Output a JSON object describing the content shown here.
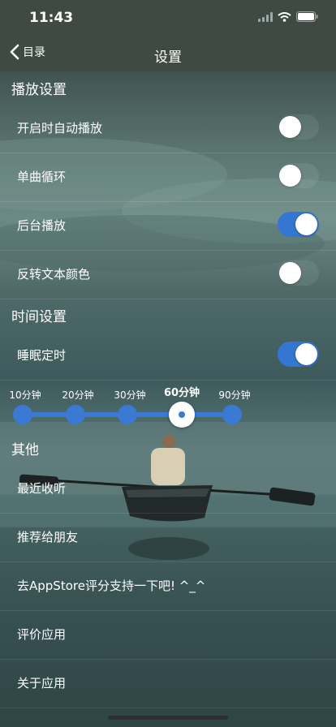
{
  "status": {
    "time": "11:43"
  },
  "nav": {
    "back_label": "目录",
    "title": "设置"
  },
  "sections": {
    "playback": "播放设置",
    "time": "时间设置",
    "other": "其他"
  },
  "playback_rows": [
    {
      "label": "开启时自动播放",
      "on": false
    },
    {
      "label": "单曲循环",
      "on": false
    },
    {
      "label": "后台播放",
      "on": true
    },
    {
      "label": "反转文本颜色",
      "on": false
    }
  ],
  "sleep_timer": {
    "label": "睡眠定时",
    "on": true
  },
  "timer_options": [
    "10分钟",
    "20分钟",
    "30分钟",
    "60分钟",
    "90分钟"
  ],
  "timer_selected": "60分钟",
  "other_rows": [
    {
      "label": "最近收听"
    },
    {
      "label": "推荐给朋友"
    },
    {
      "label": "去AppStore评分支持一下吧! ^_^"
    },
    {
      "label": "评价应用"
    },
    {
      "label": "关于应用"
    }
  ],
  "colors": {
    "accent": "#3476d2",
    "bar": "#3f4a42"
  }
}
